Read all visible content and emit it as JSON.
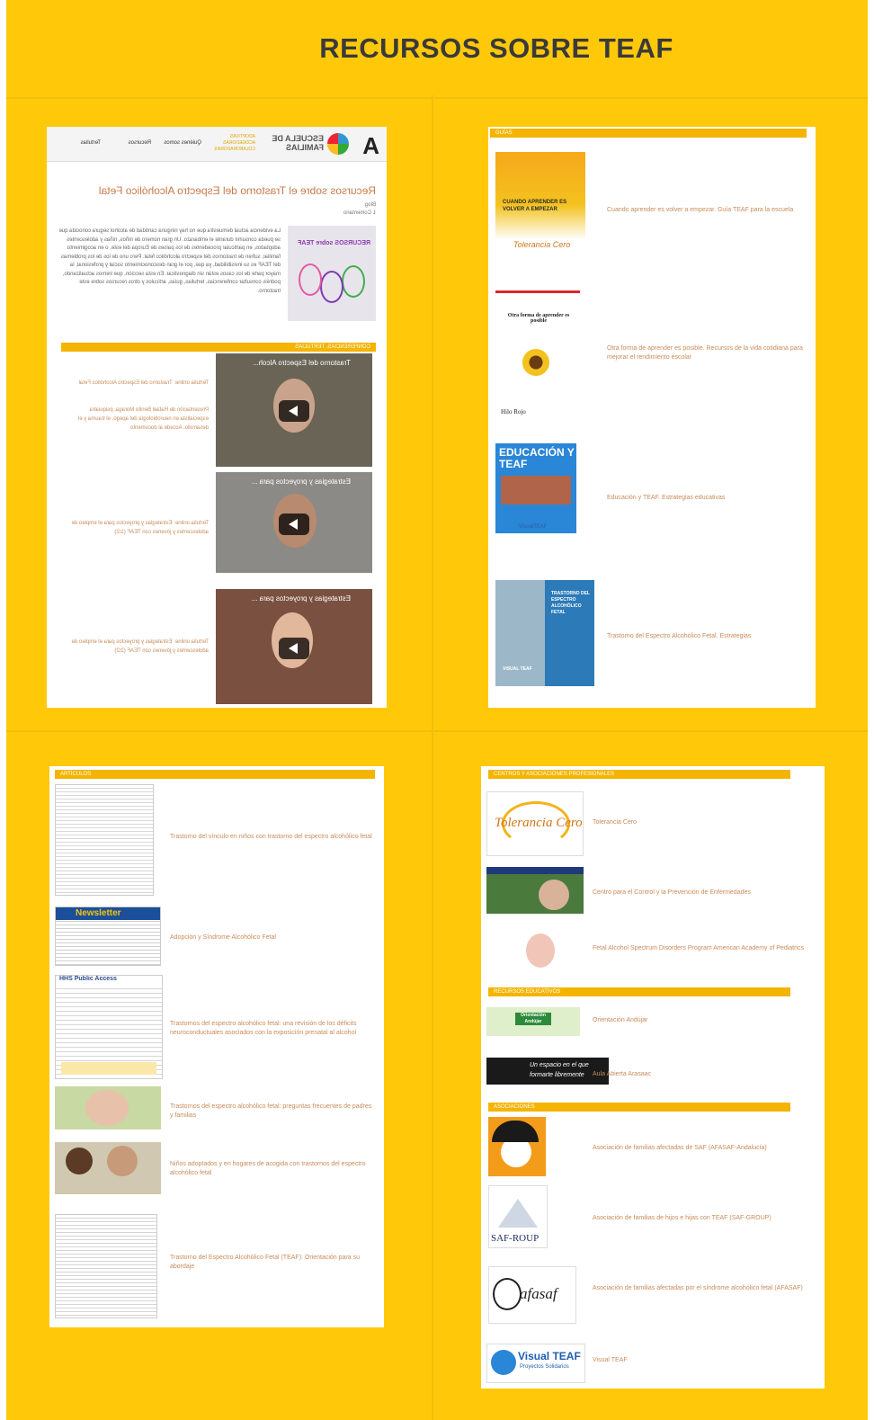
{
  "page": {
    "title": "RECURSOS SOBRE TEAF"
  },
  "panel1": {
    "nav": {
      "logo": "ESCUELA DE FAMILIAS",
      "tagline": "ADOPTIVAS ACOGEDORAS COLABORADORAS",
      "links": [
        "Quiénes somos",
        "Recursos",
        "Tertulias"
      ]
    },
    "heading": "Recursos sobre el Trastorno del Espectro Alcohólico Fetal",
    "meta": [
      "Blog",
      "1 Comentario"
    ],
    "image_caption": "RECURSOS sobre TEAF",
    "intro": "La evidencia actual demuestra que no hay ninguna cantidad de alcohol segura conocida que se pueda consumir durante el embarazo. Un gran número de niños, niñas y adolescentes adoptados, en particular procedentes de los países de Europa del este, o en acogimiento familiar, sufren de trastornos del espectro alcohólico fetal. Pero uno de los de los problemas del TEAF es su invisibilidad, ya que, por el gran desconocimiento social y profesional, la mayor parte de los casos están sin diagnosticar. En esta sección, que iremos actualizando, podréis consultar conferencias, tertulias, guías, artículos y otros recursos sobre este trastorno.",
    "section": "CONFERENCIAS, TERTULIAS",
    "videos": [
      {
        "title": "Trastorno del Espectro Alcoh...",
        "text": "Tertulia online: Trastorno del Espectro Alcohólico Fetal",
        "text2": "Presentación de Rafael Benito Moraga, psiquiatra especialista en neurobiología del apego, el trauma y el desarrollo. Accede al documento"
      },
      {
        "title": "Estrategias y proyectos para ...",
        "text": "Tertulia online: Estrategias y proyectos para el empleo de adolescentes y jóvenes con TEAF (1/2)"
      },
      {
        "title": "Estrategias y proyectos para ...",
        "text": "Tertulia online: Estrategias y proyectos para el empleo de adolescentes y jóvenes con TEAF (2/2)"
      }
    ]
  },
  "panel2": {
    "section": "GUÍAS",
    "items": [
      {
        "text": "Cuando aprender es volver a empezar. Guía TEAF para la escuela",
        "cover_title": "CUANDO APRENDER ES VOLVER A EMPEZAR",
        "cover_brand": "Tolerancia Cero"
      },
      {
        "text": "Otra forma de aprender es posible. Recursos de la vida cotidiana para mejorar el rendimiento escolar",
        "cover_title": "Otra forma de aprender es posible",
        "cover_brand": "Hilo Rojo"
      },
      {
        "text": "Educación y TEAF. Estrategias educativas",
        "cover_title": "EDUCACIÓN Y TEAF",
        "cover_brand": "VisualTEAF"
      },
      {
        "text": "Trastorno del Espectro Alcohólico Fetal. Estrategias",
        "cover_title": "TRASTORNO DEL ESPECTRO ALCOHÓLICO FETAL",
        "cover_brand": "VISUAL TEAF"
      }
    ]
  },
  "panel3": {
    "section": "ARTÍCULOS",
    "items": [
      {
        "text": "Trastorno del vínculo en niños con trastorno del espectro alcohólico fetal"
      },
      {
        "text": "Adopción y Síndrome Alcohólico Fetal",
        "cover_title": "Newsletter"
      },
      {
        "text": "Trastornos del espectro alcohólico fetal: una revisión de los déficits neuroconductuales asociados con la exposición prenatal al alcohol",
        "cover_title": "HHS Public Access"
      },
      {
        "text": "Trastornos del espectro alcohólico fetal: preguntas frecuentes de padres y familias"
      },
      {
        "text": "Niños adoptados y en hogares de acogida con trastornos del espectro alcohólico fetal"
      },
      {
        "text": "Trastorno del Espectro Alcohólico Fetal (TEAF): Orientación para su abordaje"
      }
    ]
  },
  "panel4": {
    "sections": [
      {
        "title": "CENTROS Y ASOCIACIONES PROFESIONALES",
        "items": [
          {
            "text": "Tolerancia Cero",
            "logo": "Tolerancia Cero"
          },
          {
            "text": "Centro para el Control y la Prevención de Enfermedades"
          },
          {
            "text": "Fetal Alcohol Spectrum Disorders Program American Academy of Pediatrics"
          }
        ]
      },
      {
        "title": "RECURSOS EDUCATIVOS",
        "items": [
          {
            "text": "Orientación Andújar",
            "logo": "Orientación Andújar"
          },
          {
            "text": "Aula Abierta Arasaac",
            "logo": "Un espacio en el que formarte libremente"
          }
        ]
      },
      {
        "title": "ASOCIACIONES",
        "items": [
          {
            "text": "Asociación de familias afectadas de SAF (AFASAF-Andalucía)"
          },
          {
            "text": "Asociación de familias de hijos e hijas con TEAF (SAF-GROUP)",
            "logo": "SAF-ROUP"
          },
          {
            "text": "Asociación de familias afectadas por el síndrome alcohólico fetal (AFASAF)",
            "logo": "afasaf"
          },
          {
            "text": "Visual TEAF",
            "logo": "Visual TEAF",
            "logo_sub": "Proyectos Solidarios"
          }
        ]
      }
    ]
  },
  "colors": {
    "background": "#ffc90a",
    "title": "#3a3a3a",
    "section_bar": "#f4b400",
    "link_text": "#c88b5a"
  }
}
